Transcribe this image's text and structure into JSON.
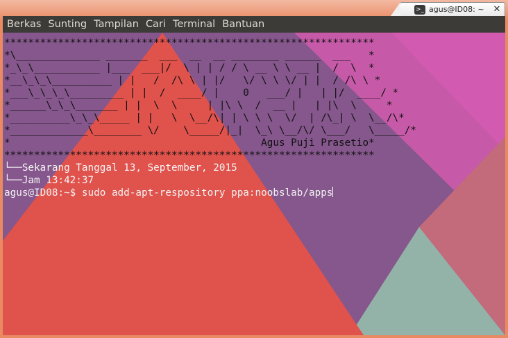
{
  "window": {
    "title": "agus@ID08: ~",
    "terminal_icon": "terminal-icon",
    "close_icon": "close-icon"
  },
  "menu": {
    "items": [
      "Berkas",
      "Sunting",
      "Tampilan",
      "Cari",
      "Terminal",
      "Bantuan"
    ]
  },
  "terminal": {
    "lines": [
      "**************************************************************",
      "*\\______________ _______  ___  __  __ ________ ______  ___   *",
      "*_\\_\\___________ |___  ___|/  \\ | | / / \\ __ \\ \\ __ |  /  \\  *",
      "*__\\_\\_\\__________ | |   /  /\\ \\ | |/   \\/ \\ \\ \\/ | |  / /\\ \\ *",
      "*___\\_\\_\\_\\_________ | |  /  ____/ |    0   ___/ |   | |/  ____/ *",
      "*______\\_\\_\\_______ | |  \\  \\     | |\\ \\  /  __ |   | |\\  \\     *",
      "*__________\\_\\_\\_____ | |   \\  \\__/\\| | \\ \\ \\  \\/  | /\\_| \\  \\__/\\*",
      "*_____________\\________ \\/    \\_____/|_|  \\_\\ \\__/\\/ \\___/   \\_____/*",
      "*                                          Agus Puji Prasetio*",
      "**************************************************************",
      "└──Sekarang Tanggal 13, September, 2015",
      "└──Jam 13:42:37"
    ],
    "prompt": "agus@ID08:~$ ",
    "command": "sudo add-apt-respository ppa:noobslab/apps"
  },
  "colors": {
    "menubar_bg": "#3c3b37",
    "menu_text": "#dfdbd2",
    "triangle_red": "#e0524c",
    "band_purple": "#85578c",
    "band_magenta": "#c65aa8",
    "mint": "#93b3a8",
    "rose": "#c36a7b"
  }
}
